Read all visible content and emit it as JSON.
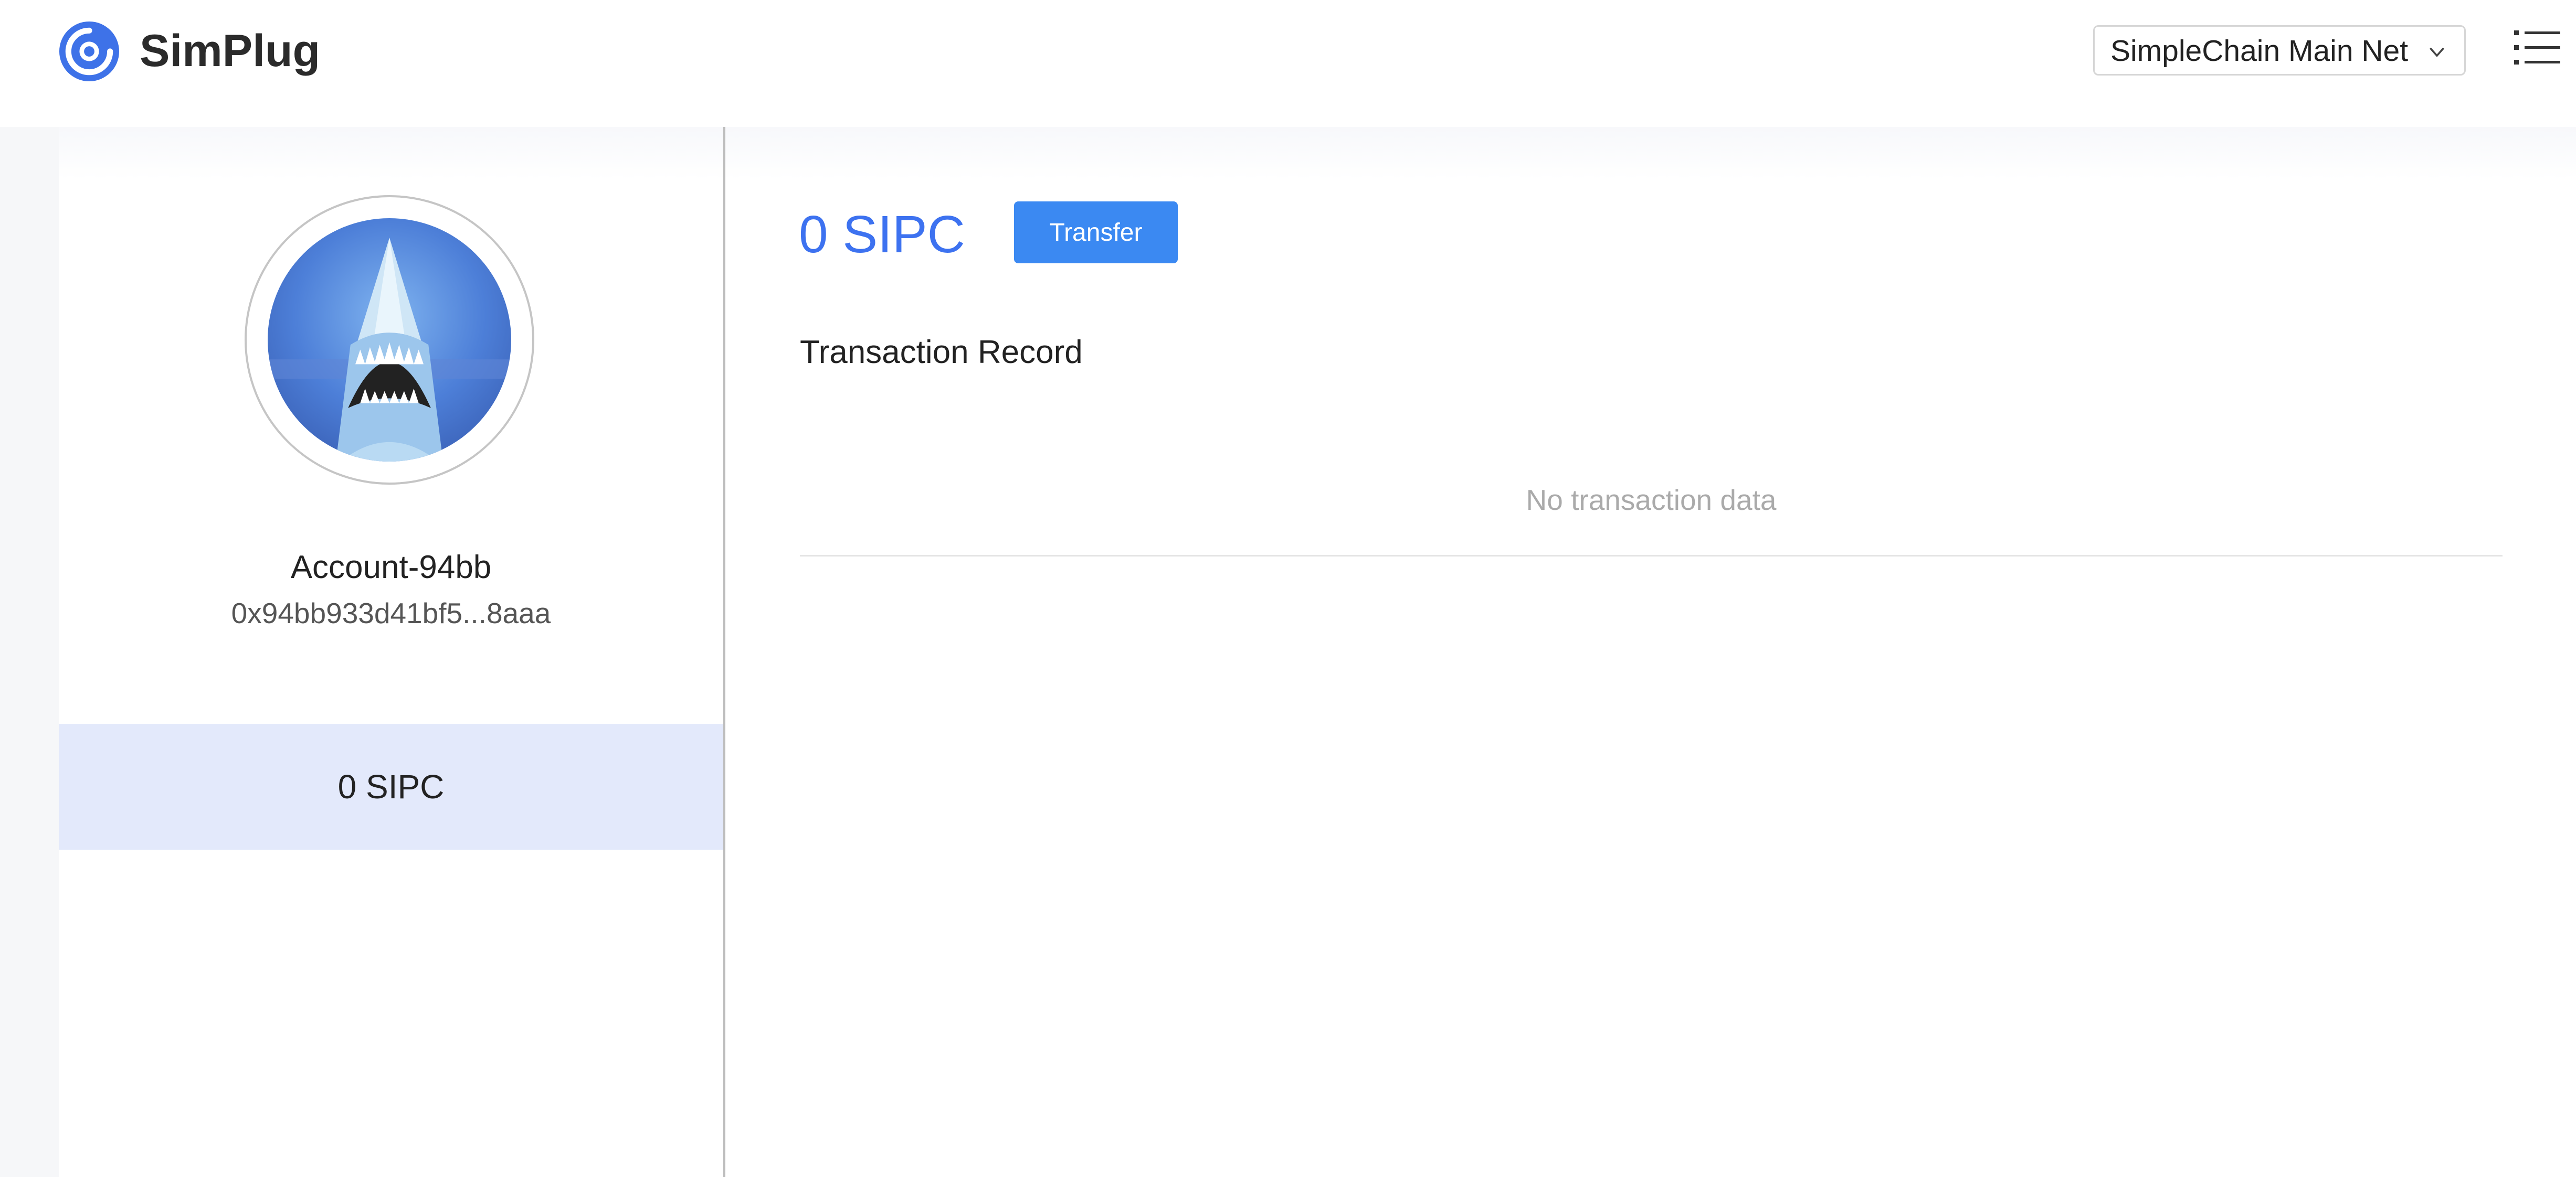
{
  "header": {
    "brand": "SimPlug",
    "logo_icon": "simplug-logo-icon",
    "network": "SimpleChain Main Net",
    "network_icon": "chevron-down-icon",
    "menu_icon": "menu-list-icon"
  },
  "account": {
    "avatar_icon": "shark-avatar-icon",
    "name": "Account-94bb",
    "address": "0x94bb933d41bf5...8aaa",
    "balance": "0 SIPC"
  },
  "main": {
    "balance": "0 SIPC",
    "transfer_label": "Transfer",
    "section_title": "Transaction Record",
    "empty_text": "No transaction data"
  },
  "colors": {
    "accent": "#3d72f0",
    "button": "#3b89f2",
    "selected_row": "#e3e9fb",
    "muted_text": "#aaaaaa"
  }
}
